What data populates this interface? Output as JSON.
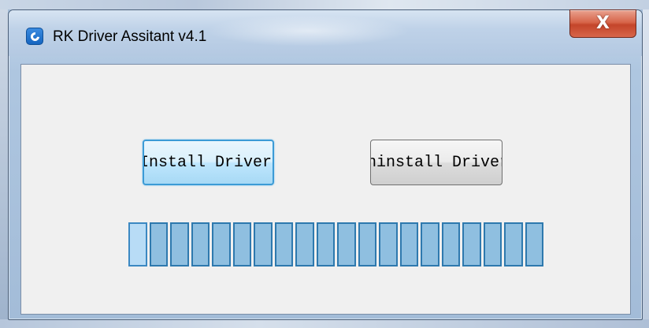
{
  "window": {
    "title": "RK Driver Assitant v4.1",
    "icon": "rk-app-icon",
    "close_glyph": "X"
  },
  "buttons": {
    "install_label": "Install Driver",
    "uninstall_label": "Uninstall Driver"
  },
  "progress": {
    "segment_count": 20,
    "highlighted_segment": 1
  },
  "colors": {
    "segment_fill": "#8fbfe0",
    "segment_border": "#2e79ae",
    "install_focus": "#3c9bd6",
    "close_red": "#c4452a"
  }
}
